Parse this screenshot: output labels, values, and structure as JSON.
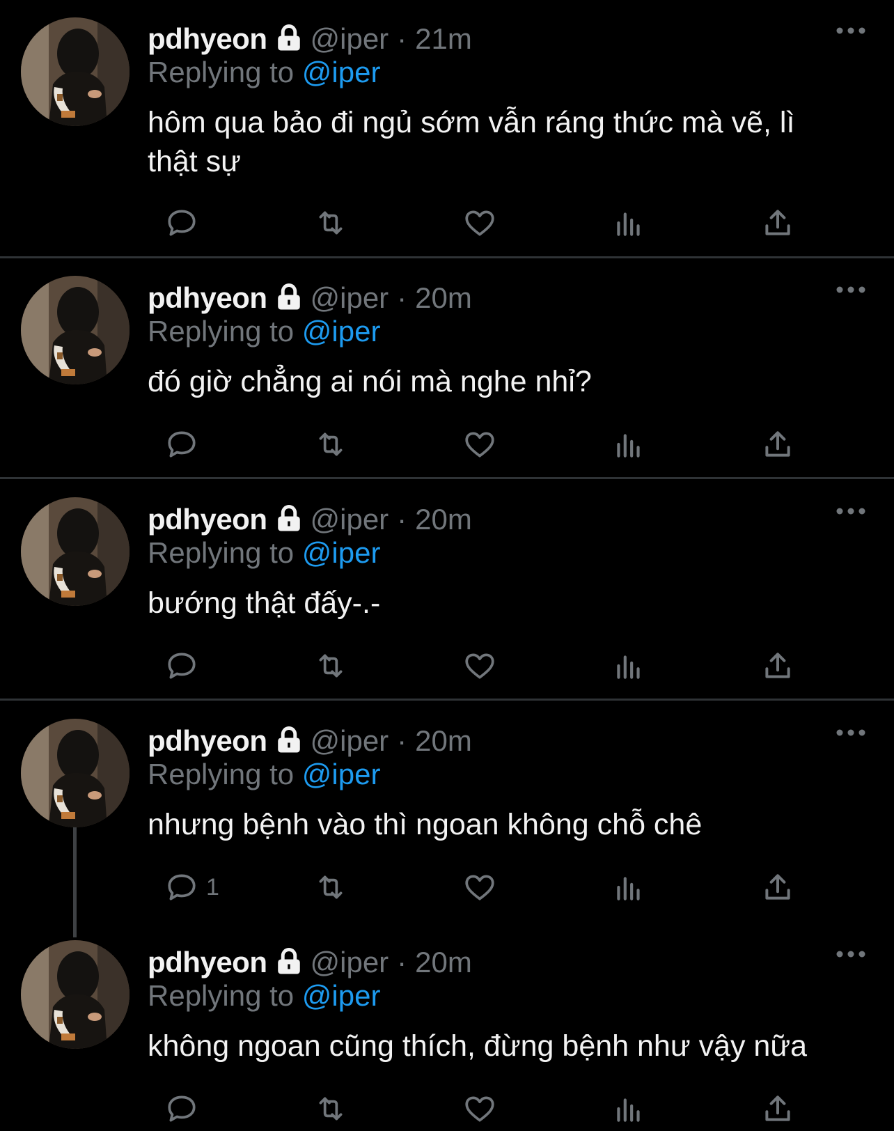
{
  "tweets": [
    {
      "name": "pdhyeon",
      "handle": "@iper",
      "time": "21m",
      "reply_prefix": "Replying to",
      "reply_to": "@iper",
      "text": "hôm qua bảo đi ngủ sớm vẫn ráng thức mà vẽ, lì thật sự",
      "reply_count": ""
    },
    {
      "name": "pdhyeon",
      "handle": "@iper",
      "time": "20m",
      "reply_prefix": "Replying to",
      "reply_to": "@iper",
      "text": "đó giờ chẳng ai nói mà nghe nhỉ?",
      "reply_count": ""
    },
    {
      "name": "pdhyeon",
      "handle": "@iper",
      "time": "20m",
      "reply_prefix": "Replying to",
      "reply_to": "@iper",
      "text": "bướng thật đấy-.-",
      "reply_count": ""
    },
    {
      "name": "pdhyeon",
      "handle": "@iper",
      "time": "20m",
      "reply_prefix": "Replying to",
      "reply_to": "@iper",
      "text": "nhưng bệnh vào thì ngoan không chỗ chê",
      "reply_count": "1"
    },
    {
      "name": "pdhyeon",
      "handle": "@iper",
      "time": "20m",
      "reply_prefix": "Replying to",
      "reply_to": "@iper",
      "text": "không ngoan cũng thích, đừng bệnh như vậy nữa",
      "reply_count": ""
    }
  ],
  "icons": [
    "lock-icon",
    "more-icon",
    "reply-icon",
    "retweet-icon",
    "like-icon",
    "views-icon",
    "share-icon"
  ],
  "colors": {
    "background": "#000000",
    "accent": "#1d9bf0",
    "muted": "#71767b",
    "divider": "#2f3336"
  }
}
